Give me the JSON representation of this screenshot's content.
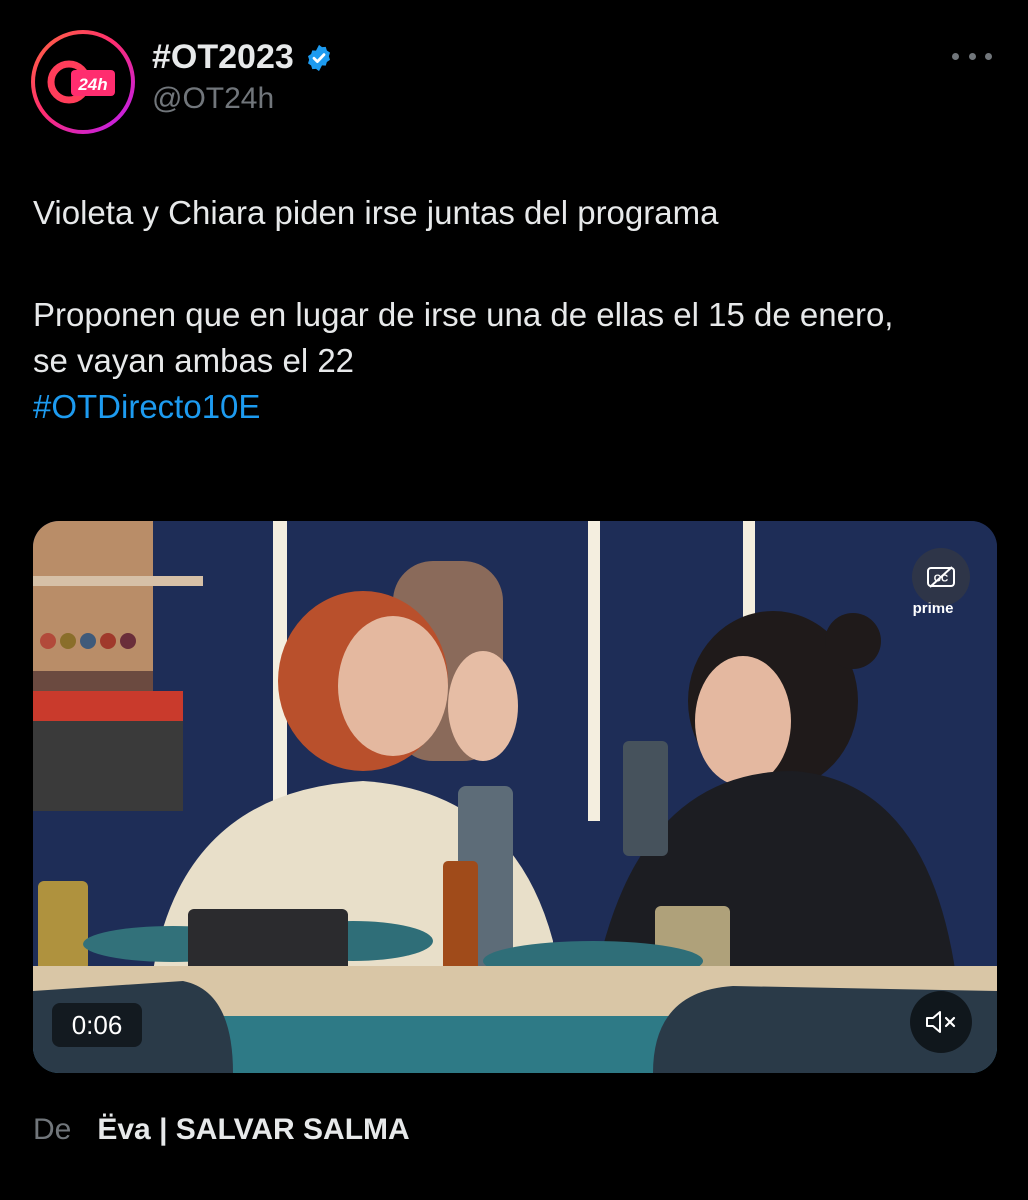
{
  "account": {
    "display_name": "#OT2023",
    "handle": "@OT24h",
    "avatar_text": "24h",
    "verified_icon": "verified-badge-icon"
  },
  "tweet": {
    "line1": "Violeta y Chiara piden irse juntas del programa",
    "line2": "Proponen que en lugar de irse una de ellas el 15 de enero, se vayan ambas el 22",
    "hashtag": "#OTDirecto10E"
  },
  "video": {
    "timestamp": "0:06",
    "overlay_logo": "prime",
    "cc_icon": "closed-captions-icon",
    "mute_icon": "muted-speaker-icon"
  },
  "source": {
    "label": "De",
    "name": "Ëva | SALVAR SALMA"
  },
  "colors": {
    "background": "#000000",
    "text": "#e7e9ea",
    "muted": "#71767b",
    "link": "#1d9bf0",
    "verified": "#1d9bf0"
  }
}
